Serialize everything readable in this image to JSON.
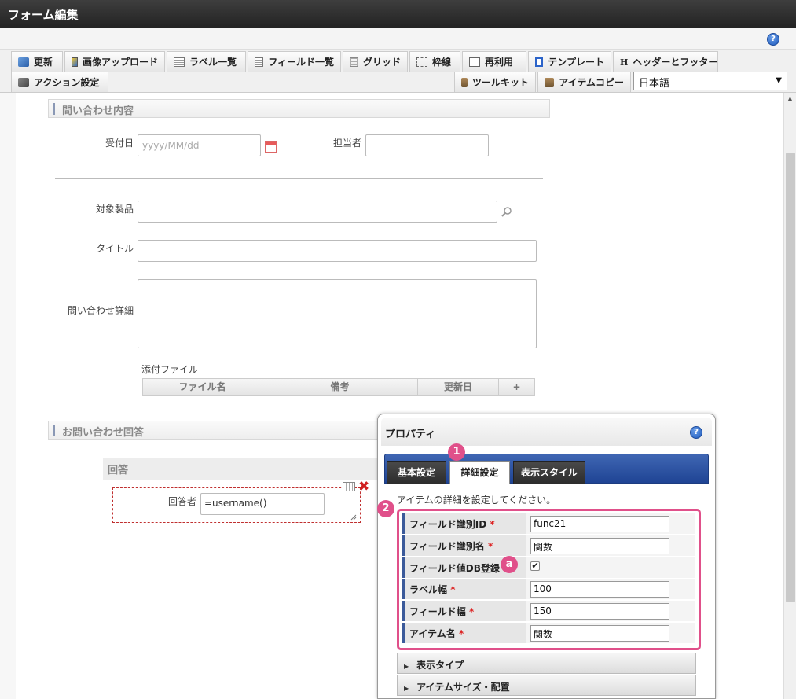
{
  "window": {
    "title": "フォーム編集"
  },
  "toolbar": {
    "row1": [
      {
        "name": "update-button",
        "icon": "refresh-icon",
        "label": "更新"
      },
      {
        "name": "image-upload-button",
        "icon": "image-icon",
        "label": "画像アップロード"
      },
      {
        "name": "label-list-button",
        "icon": "list-icon",
        "label": "ラベル一覧"
      },
      {
        "name": "field-list-button",
        "icon": "list-icon",
        "label": "フィールド一覧"
      },
      {
        "name": "grid-button",
        "icon": "grid-icon",
        "label": "グリッド"
      },
      {
        "name": "frame-button",
        "icon": "frame-icon",
        "label": "枠線"
      },
      {
        "name": "reuse-button",
        "icon": "document-icon",
        "label": "再利用"
      },
      {
        "name": "template-button",
        "icon": "template-icon",
        "label": "テンプレート"
      },
      {
        "name": "header-footer-button",
        "icon": "header-icon",
        "label": "ヘッダーとフッター"
      }
    ],
    "action_label": "アクション設定",
    "toolkit_label": "ツールキット",
    "item_copy_label": "アイテムコピー",
    "language": "日本語"
  },
  "form": {
    "section1": "問い合わせ内容",
    "received_date_label": "受付日",
    "received_date_placeholder": "yyyy/MM/dd",
    "assignee_label": "担当者",
    "product_label": "対象製品",
    "title_label": "タイトル",
    "detail_label": "問い合わせ詳細",
    "attachment_label": "添付ファイル",
    "attachment_columns": [
      "ファイル名",
      "備考",
      "更新日"
    ],
    "section2": "お問い合わせ回答",
    "answer_group": "回答",
    "responder_label": "回答者",
    "responder_value": "=username()"
  },
  "properties": {
    "title": "プロパティ",
    "tabs": [
      "基本設定",
      "詳細設定",
      "表示スタイル"
    ],
    "active_tab": "詳細設定",
    "description": "アイテムの詳細を設定してください。",
    "rows": [
      {
        "label": "フィールド識別ID",
        "required": "*",
        "value": "func21"
      },
      {
        "label": "フィールド識別名",
        "required": "*",
        "value": "関数"
      },
      {
        "label": "フィールド値DB登録",
        "required": "",
        "checked": "✔"
      },
      {
        "label": "ラベル幅",
        "required": "*",
        "value": "100"
      },
      {
        "label": "フィールド幅",
        "required": "*",
        "value": "150"
      },
      {
        "label": "アイテム名",
        "required": "*",
        "value": "関数"
      }
    ],
    "accordions": [
      "表示タイプ",
      "アイテムサイズ・配置"
    ]
  },
  "annotations": {
    "badge1": "1",
    "badge2": "2",
    "badge_a": "a"
  },
  "colors": {
    "accent_badge": "#e0508a",
    "tab_bar": "#1f4494"
  }
}
